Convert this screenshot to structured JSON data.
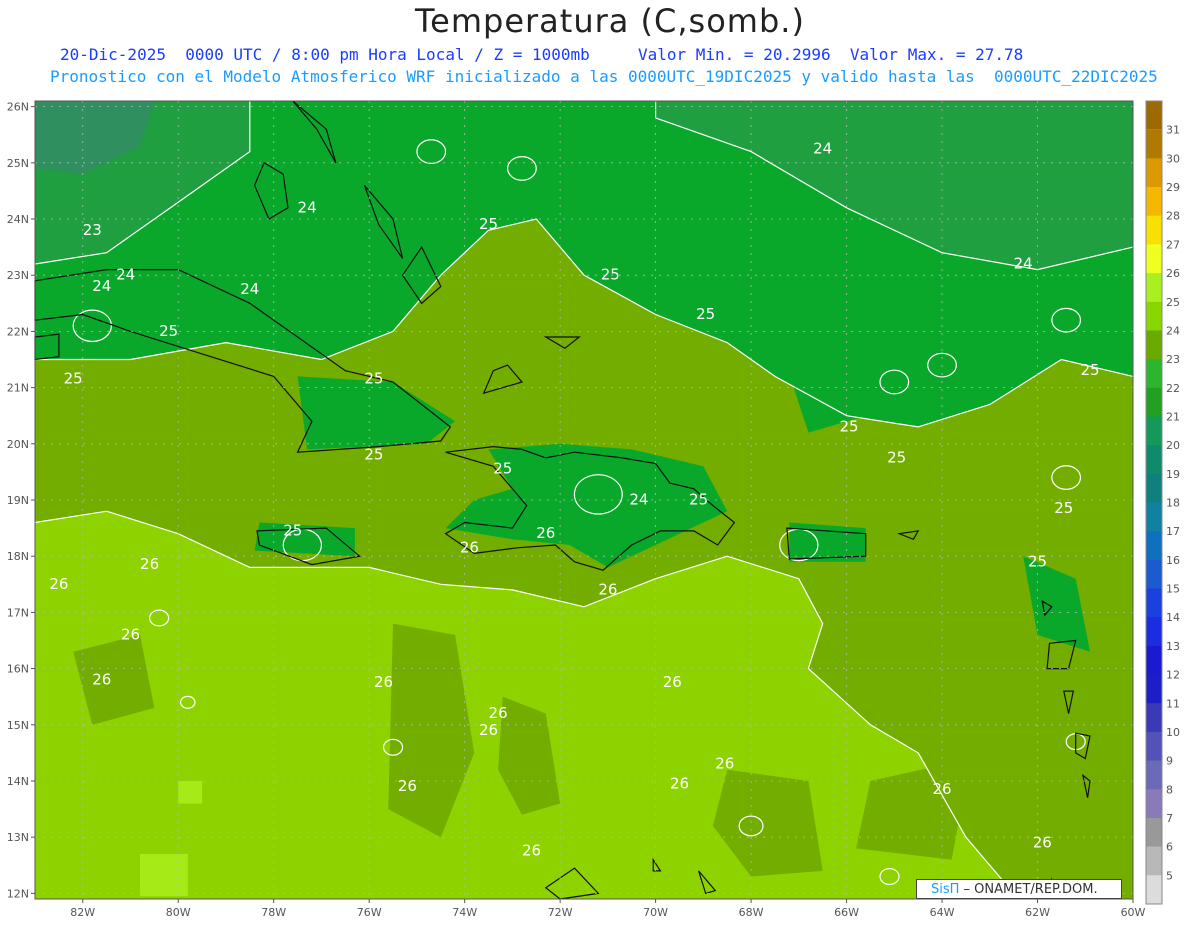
{
  "header": {
    "title": "Temperatura (C,somb.)",
    "subtitle_1": "20-Dic-2025  0000 UTC / 8:00 pm Hora Local / Z = 1000mb     Valor Min. = 20.2996  Valor Max. = 27.78",
    "subtitle_2": "Pronostico con el Modelo Atmosferico WRF inicializado a las 0000UTC_19DIC2025 y valido hasta las  0000UTC_22DIC2025"
  },
  "map": {
    "lat_labels": [
      "26N",
      "25N",
      "24N",
      "23N",
      "22N",
      "21N",
      "20N",
      "19N",
      "18N",
      "17N",
      "16N",
      "15N",
      "14N",
      "13N",
      "12N"
    ],
    "lon_labels": [
      "82W",
      "80W",
      "78W",
      "76W",
      "74W",
      "72W",
      "70W",
      "68W",
      "66W",
      "64W",
      "62W",
      "60W"
    ],
    "contour_labels": [
      {
        "text": "24",
        "lat": 25.25,
        "lon": -66.5
      },
      {
        "text": "23",
        "lat": 23.8,
        "lon": -81.8
      },
      {
        "text": "24",
        "lat": 24.2,
        "lon": -77.3
      },
      {
        "text": "24",
        "lat": 23.0,
        "lon": -81.1
      },
      {
        "text": "24",
        "lat": 22.8,
        "lon": -81.6
      },
      {
        "text": "24",
        "lat": 22.75,
        "lon": -78.5
      },
      {
        "text": "25",
        "lat": 23.9,
        "lon": -73.5
      },
      {
        "text": "25",
        "lat": 23.0,
        "lon": -70.95
      },
      {
        "text": "25",
        "lat": 22.3,
        "lon": -68.95
      },
      {
        "text": "24",
        "lat": 23.2,
        "lon": -62.3
      },
      {
        "text": "25",
        "lat": 22.0,
        "lon": -80.2
      },
      {
        "text": "25",
        "lat": 21.15,
        "lon": -82.2
      },
      {
        "text": "25",
        "lat": 21.15,
        "lon": -75.9
      },
      {
        "text": "25",
        "lat": 21.3,
        "lon": -60.9
      },
      {
        "text": "25",
        "lat": 20.3,
        "lon": -65.95
      },
      {
        "text": "25",
        "lat": 19.75,
        "lon": -64.95
      },
      {
        "text": "25",
        "lat": 19.55,
        "lon": -73.2
      },
      {
        "text": "25",
        "lat": 19.8,
        "lon": -75.9
      },
      {
        "text": "24",
        "lat": 19.0,
        "lon": -70.35
      },
      {
        "text": "25",
        "lat": 19.0,
        "lon": -69.1
      },
      {
        "text": "25",
        "lat": 18.85,
        "lon": -61.45
      },
      {
        "text": "25",
        "lat": 18.45,
        "lon": -77.6
      },
      {
        "text": "26",
        "lat": 18.15,
        "lon": -73.9
      },
      {
        "text": "26",
        "lat": 18.4,
        "lon": -72.3
      },
      {
        "text": "25",
        "lat": 17.9,
        "lon": -62.0
      },
      {
        "text": "26",
        "lat": 17.85,
        "lon": -80.6
      },
      {
        "text": "26",
        "lat": 17.5,
        "lon": -82.5
      },
      {
        "text": "26",
        "lat": 17.4,
        "lon": -71.0
      },
      {
        "text": "26",
        "lat": 16.6,
        "lon": -81.0
      },
      {
        "text": "26",
        "lat": 15.8,
        "lon": -81.6
      },
      {
        "text": "26",
        "lat": 15.75,
        "lon": -75.7
      },
      {
        "text": "26",
        "lat": 15.75,
        "lon": -69.65
      },
      {
        "text": "26",
        "lat": 15.2,
        "lon": -73.3
      },
      {
        "text": "26",
        "lat": 14.9,
        "lon": -73.5
      },
      {
        "text": "26",
        "lat": 14.3,
        "lon": -68.55
      },
      {
        "text": "26",
        "lat": 13.9,
        "lon": -75.2
      },
      {
        "text": "26",
        "lat": 13.95,
        "lon": -69.5
      },
      {
        "text": "26",
        "lat": 13.85,
        "lon": -64.0
      },
      {
        "text": "26",
        "lat": 12.75,
        "lon": -72.6
      },
      {
        "text": "26",
        "lat": 12.9,
        "lon": -61.9
      }
    ]
  },
  "colorbar": {
    "labels": [
      "31",
      "30",
      "29",
      "28",
      "27",
      "26",
      "25",
      "24",
      "23",
      "22",
      "21",
      "20",
      "19",
      "18",
      "17",
      "16",
      "15",
      "14",
      "13",
      "12",
      "11",
      "10",
      "9",
      "8",
      "7",
      "6",
      "5"
    ],
    "colors": [
      "#b07a00",
      "#dd9a00",
      "#f5b800",
      "#f8e000",
      "#f0ff20",
      "#aaf020",
      "#88d800",
      "#6aaa00",
      "#2db52d",
      "#22a022",
      "#139a5a",
      "#0f8a6a",
      "#10807e",
      "#1081a0",
      "#1070c0",
      "#1a5cd0",
      "#1a40e0",
      "#1a2de0",
      "#1a1ad0",
      "#1e1ec8",
      "#3a3ab8",
      "#5252b8",
      "#6a6ab8",
      "#8a7ab8",
      "#999999",
      "#b8b8b8",
      "#dcdcdc"
    ],
    "top_label": ""
  },
  "field_colors": {
    "t22": "#2f8f5f",
    "t23": "#1f9f3f",
    "t24": "#0aa82a",
    "t25": "#72ad00",
    "t26": "#8ed300",
    "t27": "#a6ea18"
  },
  "credit": {
    "brand": "SisΠ",
    "org": " – ONAMET/REP.DOM."
  }
}
